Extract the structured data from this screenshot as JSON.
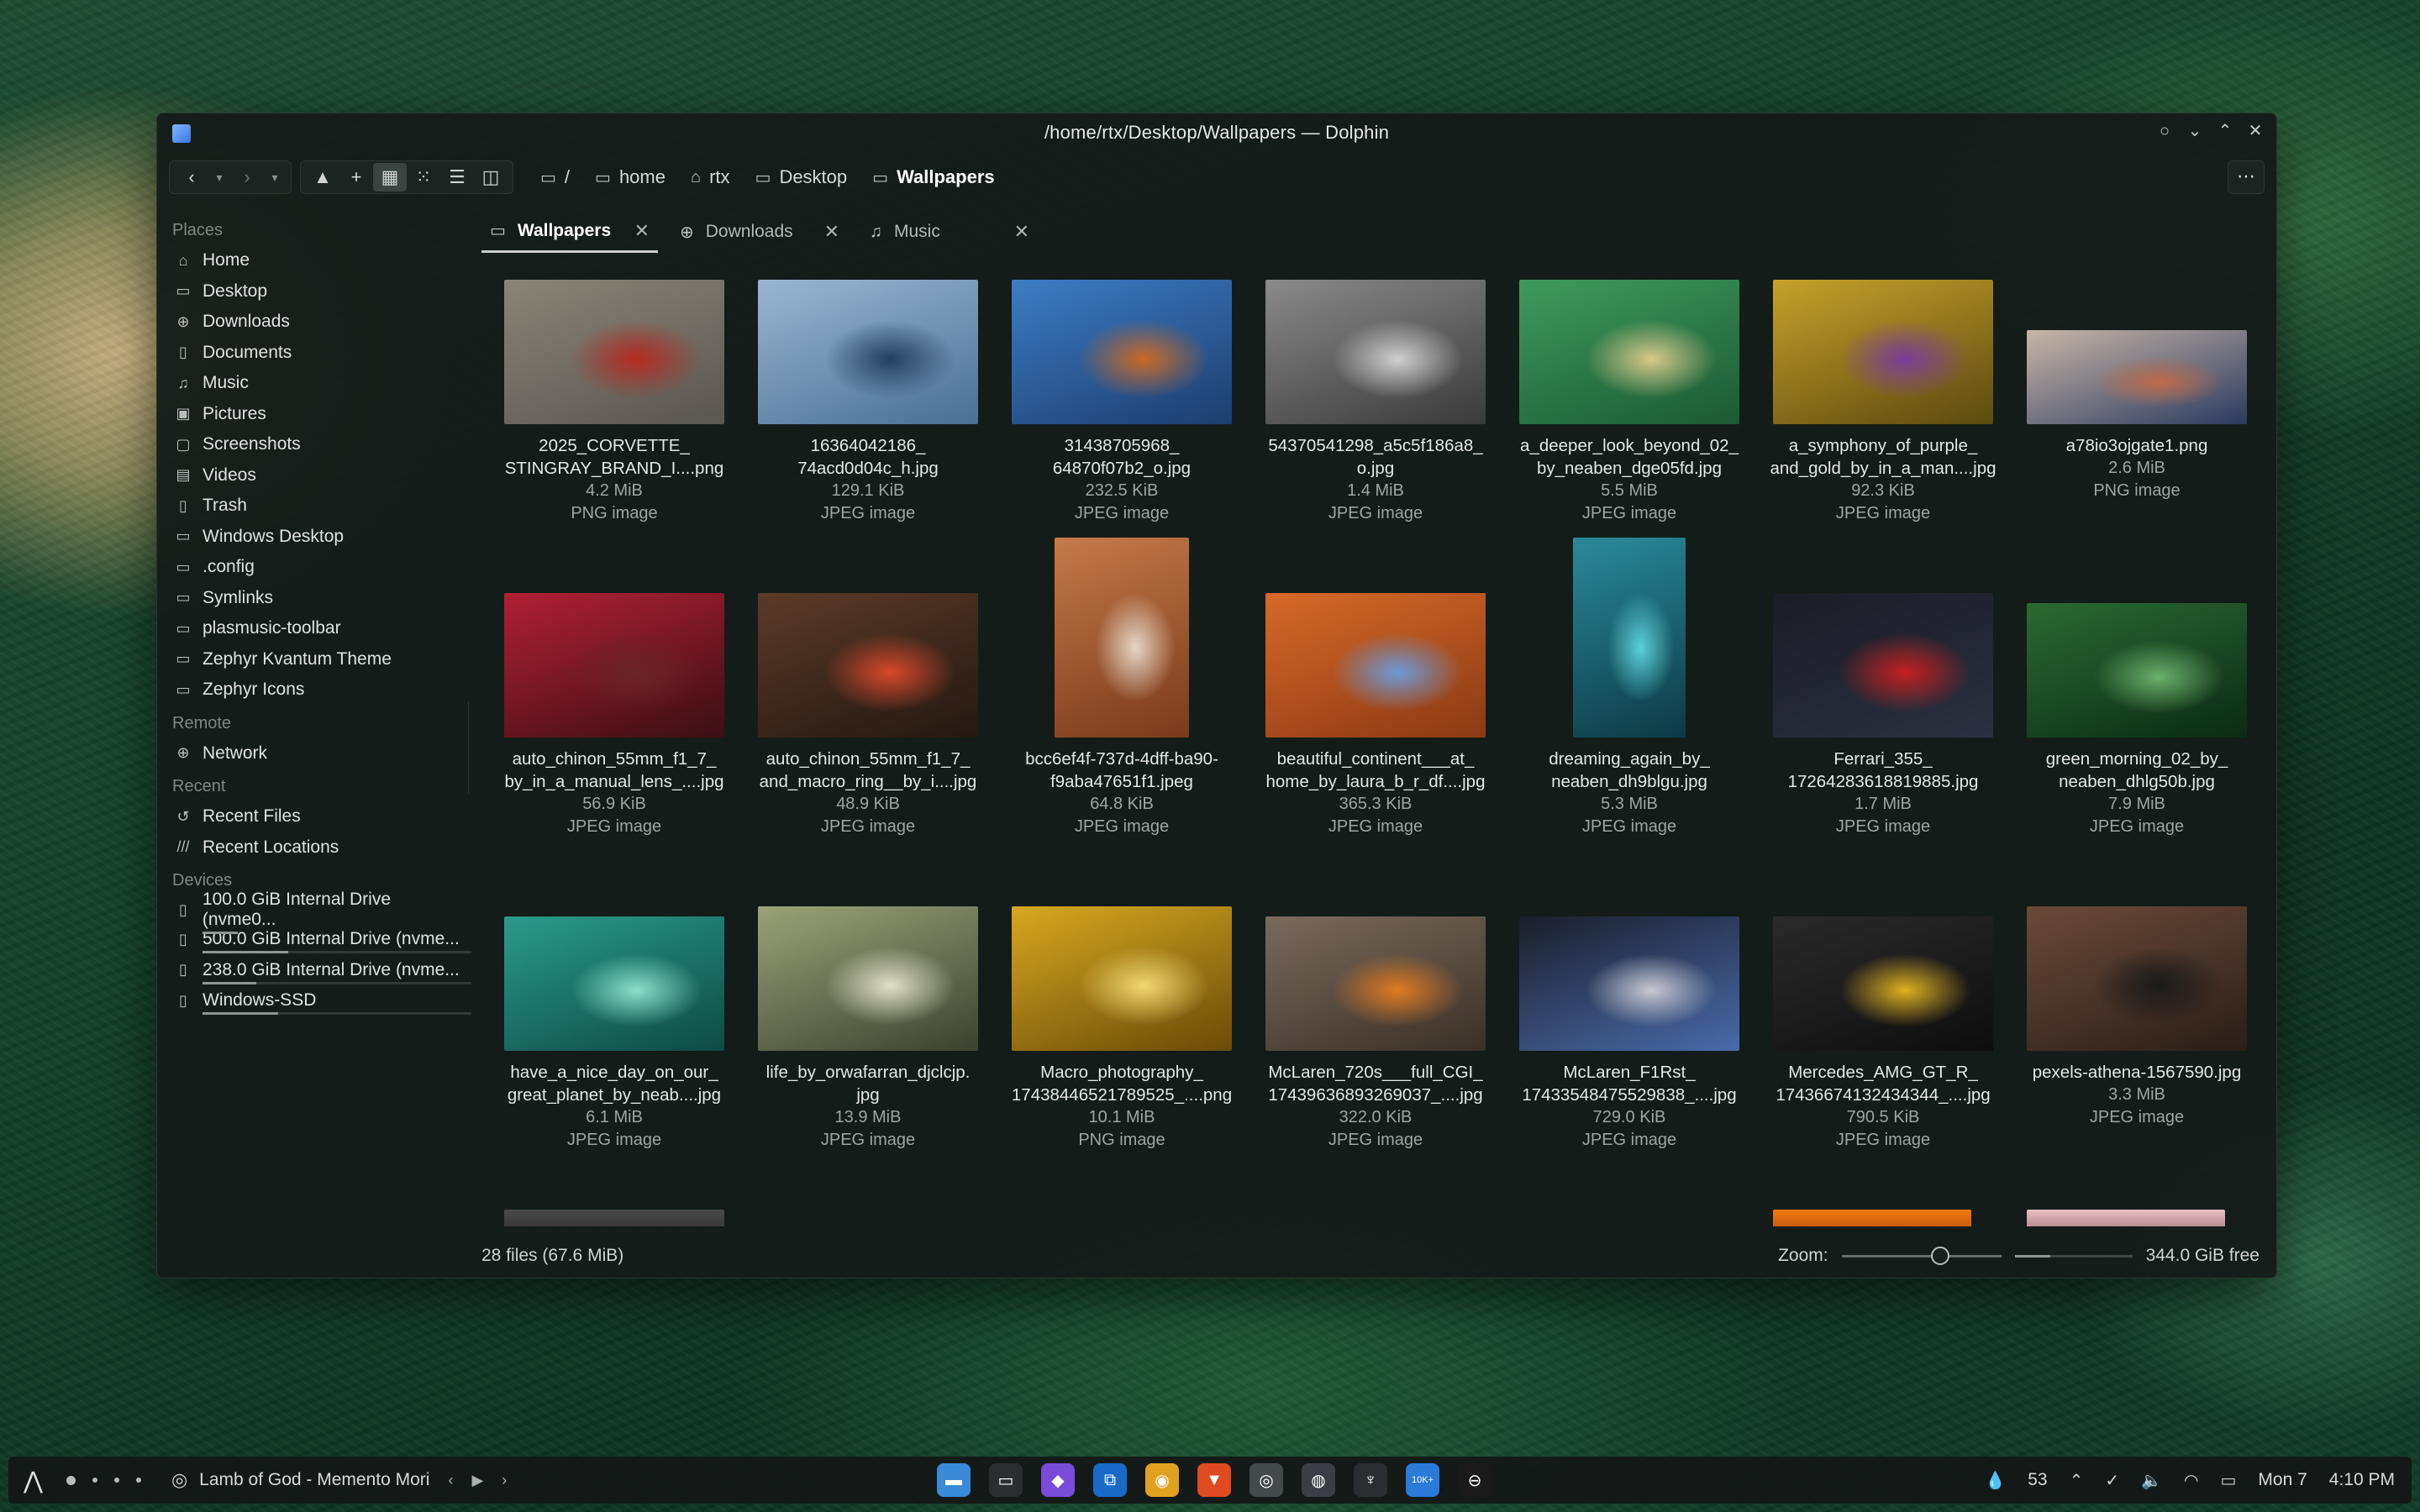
{
  "window": {
    "title": "/home/rtx/Desktop/Wallpapers — Dolphin",
    "menu_label": "⋯"
  },
  "breadcrumbs": [
    {
      "label": "/",
      "icon": "folder-icon"
    },
    {
      "label": "home",
      "icon": "folder-icon"
    },
    {
      "label": "rtx",
      "icon": "home-icon"
    },
    {
      "label": "Desktop",
      "icon": "desktop-icon"
    },
    {
      "label": "Wallpapers",
      "icon": "folder-icon"
    }
  ],
  "sidebar": {
    "places_title": "Places",
    "places": [
      {
        "label": "Home",
        "icon": "home-icon",
        "glyph": "⌂"
      },
      {
        "label": "Desktop",
        "icon": "desktop-icon",
        "glyph": "▭"
      },
      {
        "label": "Downloads",
        "icon": "download-icon",
        "glyph": "⊕"
      },
      {
        "label": "Documents",
        "icon": "document-icon",
        "glyph": "▯"
      },
      {
        "label": "Music",
        "icon": "music-icon",
        "glyph": "♫"
      },
      {
        "label": "Pictures",
        "icon": "picture-icon",
        "glyph": "▣"
      },
      {
        "label": "Screenshots",
        "icon": "screenshot-icon",
        "glyph": "▢"
      },
      {
        "label": "Videos",
        "icon": "video-icon",
        "glyph": "▤"
      },
      {
        "label": "Trash",
        "icon": "trash-icon",
        "glyph": "▯"
      },
      {
        "label": "Windows Desktop",
        "icon": "folder-icon",
        "glyph": "▭"
      },
      {
        "label": ".config",
        "icon": "folder-icon",
        "glyph": "▭"
      },
      {
        "label": "Symlinks",
        "icon": "folder-icon",
        "glyph": "▭"
      },
      {
        "label": "plasmusic-toolbar",
        "icon": "folder-icon",
        "glyph": "▭"
      },
      {
        "label": "Zephyr Kvantum Theme",
        "icon": "folder-icon",
        "glyph": "▭"
      },
      {
        "label": "Zephyr Icons",
        "icon": "folder-icon",
        "glyph": "▭"
      }
    ],
    "remote_title": "Remote",
    "remote": [
      {
        "label": "Network",
        "icon": "network-icon",
        "glyph": "⊕"
      }
    ],
    "recent_title": "Recent",
    "recent": [
      {
        "label": "Recent Files",
        "icon": "history-icon",
        "glyph": "↺"
      },
      {
        "label": "Recent Locations",
        "icon": "recent-locations-icon",
        "glyph": "///"
      }
    ],
    "devices_title": "Devices",
    "devices": [
      {
        "label": "100.0 GiB Internal Drive (nvme0...",
        "icon": "drive-icon",
        "usage": 0.13
      },
      {
        "label": "500.0 GiB Internal Drive (nvme...",
        "icon": "drive-icon",
        "usage": 0.32
      },
      {
        "label": "238.0 GiB Internal Drive (nvme...",
        "icon": "drive-icon",
        "usage": 0.2
      },
      {
        "label": "Windows-SSD",
        "icon": "drive-icon",
        "usage": 0.28
      }
    ]
  },
  "tabs": [
    {
      "label": "Wallpapers",
      "icon": "folder-icon",
      "glyph": "▭",
      "active": true
    },
    {
      "label": "Downloads",
      "icon": "download-icon",
      "glyph": "⊕",
      "active": false
    },
    {
      "label": "Music",
      "icon": "music-icon",
      "glyph": "♫",
      "active": false
    }
  ],
  "files": [
    {
      "name": "2025_CORVETTE_\nSTINGRAY_BRAND_I....png",
      "size": "4.2 MiB",
      "type": "PNG image",
      "shape": "landscape",
      "colors": [
        "#8a8478",
        "#5a5650",
        "#b52a20"
      ]
    },
    {
      "name": "16364042186_\n74acd0d04c_h.jpg",
      "size": "129.1 KiB",
      "type": "JPEG image",
      "shape": "landscape",
      "colors": [
        "#9bb6d0",
        "#4a6f95",
        "#26405e"
      ]
    },
    {
      "name": "31438705968_\n64870f07b2_o.jpg",
      "size": "232.5 KiB",
      "type": "JPEG image",
      "shape": "landscape",
      "colors": [
        "#3d7cc4",
        "#1c3e6e",
        "#c96a24"
      ]
    },
    {
      "name": "54370541298_a5c5f186a8_\no.jpg",
      "size": "1.4 MiB",
      "type": "JPEG image",
      "shape": "landscape",
      "colors": [
        "#8a8a8a",
        "#3a3a3a",
        "#cfcfcf"
      ]
    },
    {
      "name": "a_deeper_look_beyond_02_\nby_neaben_dge05fd.jpg",
      "size": "5.5 MiB",
      "type": "JPEG image",
      "shape": "landscape",
      "colors": [
        "#3f9a5d",
        "#1b5a34",
        "#d9c88a"
      ]
    },
    {
      "name": "a_symphony_of_purple_\nand_gold_by_in_a_man....jpg",
      "size": "92.3 KiB",
      "type": "JPEG image",
      "shape": "landscape",
      "colors": [
        "#c7a12a",
        "#5a4a10",
        "#7a3e9a"
      ]
    },
    {
      "name": "a78io3ojgate1.png",
      "size": "2.6 MiB",
      "type": "PNG image",
      "shape": "wide",
      "colors": [
        "#c8b6a8",
        "#2b3a5e",
        "#c06a4a"
      ]
    },
    {
      "name": "auto_chinon_55mm_f1_7_\nby_in_a_manual_lens_....jpg",
      "size": "56.9 KiB",
      "type": "JPEG image",
      "shape": "landscape",
      "colors": [
        "#b21f35",
        "#3a0f14",
        "#6a2428"
      ]
    },
    {
      "name": "auto_chinon_55mm_f1_7_\nand_macro_ring__by_i....jpg",
      "size": "48.9 KiB",
      "type": "JPEG image",
      "shape": "landscape",
      "colors": [
        "#5a3a28",
        "#241812",
        "#d8482a"
      ]
    },
    {
      "name": "bcc6ef4f-737d-4dff-ba90-\nf9aba47651f1.jpeg",
      "size": "64.8 KiB",
      "type": "JPEG image",
      "shape": "portrait",
      "colors": [
        "#c47a4a",
        "#7a3a1a",
        "#e6d6c6"
      ]
    },
    {
      "name": "beautiful_continent___at_\nhome_by_laura_b_r_df....jpg",
      "size": "365.3 KiB",
      "type": "JPEG image",
      "shape": "landscape",
      "colors": [
        "#d8682a",
        "#8a3a14",
        "#6a9ad6"
      ]
    },
    {
      "name": "dreaming_again_by_\nneaben_dh9blgu.jpg",
      "size": "5.3 MiB",
      "type": "JPEG image",
      "shape": "tall",
      "colors": [
        "#2a8a9a",
        "#0c3a44",
        "#5ad0d8"
      ]
    },
    {
      "name": "Ferrari_355_\n17264283618819885.jpg",
      "size": "1.7 MiB",
      "type": "JPEG image",
      "shape": "landscape",
      "colors": [
        "#1a1c26",
        "#2c3040",
        "#c42020"
      ]
    },
    {
      "name": "green_morning_02_by_\nneaben_dhlg50b.jpg",
      "size": "7.9 MiB",
      "type": "JPEG image",
      "shape": "landscape-short",
      "colors": [
        "#2a6a34",
        "#0c2a14",
        "#6ab06a"
      ]
    },
    {
      "name": "have_a_nice_day_on_our_\ngreat_planet_by_neab....jpg",
      "size": "6.1 MiB",
      "type": "JPEG image",
      "shape": "landscape-short",
      "colors": [
        "#2a9a8a",
        "#0e4a44",
        "#8ae0c8"
      ]
    },
    {
      "name": "life_by_orwafarran_djclcjp.\njpg",
      "size": "13.9 MiB",
      "type": "JPEG image",
      "shape": "landscape",
      "colors": [
        "#9aa27a",
        "#3a4230",
        "#e0e0c8"
      ]
    },
    {
      "name": "Macro_photography_\n17438446521789525_....png",
      "size": "10.1 MiB",
      "type": "PNG image",
      "shape": "landscape",
      "colors": [
        "#d8a820",
        "#6a4a08",
        "#f0d870"
      ]
    },
    {
      "name": "McLaren_720s___full_CGI_\n17439636893269037_....jpg",
      "size": "322.0 KiB",
      "type": "JPEG image",
      "shape": "landscape-short",
      "colors": [
        "#7a6a5a",
        "#3a3028",
        "#e07a20"
      ]
    },
    {
      "name": "McLaren_F1Rst_\n17433548475529838_....jpg",
      "size": "729.0 KiB",
      "type": "JPEG image",
      "shape": "landscape-short",
      "colors": [
        "#1a1e2a",
        "#4a6aaa",
        "#c8c8d0"
      ]
    },
    {
      "name": "Mercedes_AMG_GT_R_\n17436674132434344_....jpg",
      "size": "790.5 KiB",
      "type": "JPEG image",
      "shape": "landscape-short",
      "colors": [
        "#2a2a2a",
        "#0e0e0e",
        "#e0b020"
      ]
    },
    {
      "name": "pexels-athena-1567590.jpg",
      "size": "3.3 MiB",
      "type": "JPEG image",
      "shape": "landscape",
      "colors": [
        "#6a4a3a",
        "#2a1e18",
        "#1a1a1a"
      ]
    }
  ],
  "partial_thumbs": [
    {
      "colors": [
        "#4a4a4a",
        "#2a2a2a"
      ]
    },
    {
      "colors": [
        "#f07a10",
        "#a8400a"
      ]
    },
    {
      "colors": [
        "#e8c0c0",
        "#8a5a6a"
      ]
    }
  ],
  "status": {
    "count": "28 files (67.6 MiB)",
    "zoom_label": "Zoom:",
    "zoom_level": 0.62,
    "space_used_fraction": 0.3,
    "free_space": "344.0 GiB free"
  },
  "taskbar": {
    "media_title": "Lamb of God - Memento Mori",
    "apps": [
      {
        "name": "dolphin-app-icon",
        "color": "#3a8ad8",
        "glyph": "▬"
      },
      {
        "name": "terminal-app-icon",
        "color": "#2a2e30",
        "glyph": "▭"
      },
      {
        "name": "obsidian-app-icon",
        "color": "#7a4ad8",
        "glyph": "◆"
      },
      {
        "name": "vscode-app-icon",
        "color": "#1a6ac8",
        "glyph": "⧉"
      },
      {
        "name": "chrome-app-icon",
        "color": "#e0a020",
        "glyph": "◉"
      },
      {
        "name": "brave-app-icon",
        "color": "#e04a20",
        "glyph": "▼"
      },
      {
        "name": "app-7-icon",
        "color": "#444a4c",
        "glyph": "◎"
      },
      {
        "name": "steam-app-icon",
        "color": "#3a3e44",
        "glyph": "◍"
      },
      {
        "name": "app-9-icon",
        "color": "#2a2e30",
        "glyph": "♆"
      },
      {
        "name": "app-10-icon",
        "color": "#2a7ad8",
        "glyph": "10K+"
      },
      {
        "name": "app-11-icon",
        "color": "#1a1a1a",
        "glyph": "⊖"
      }
    ],
    "tray": {
      "temp": "53",
      "date": "Mon 7",
      "time": "4:10 PM"
    }
  }
}
